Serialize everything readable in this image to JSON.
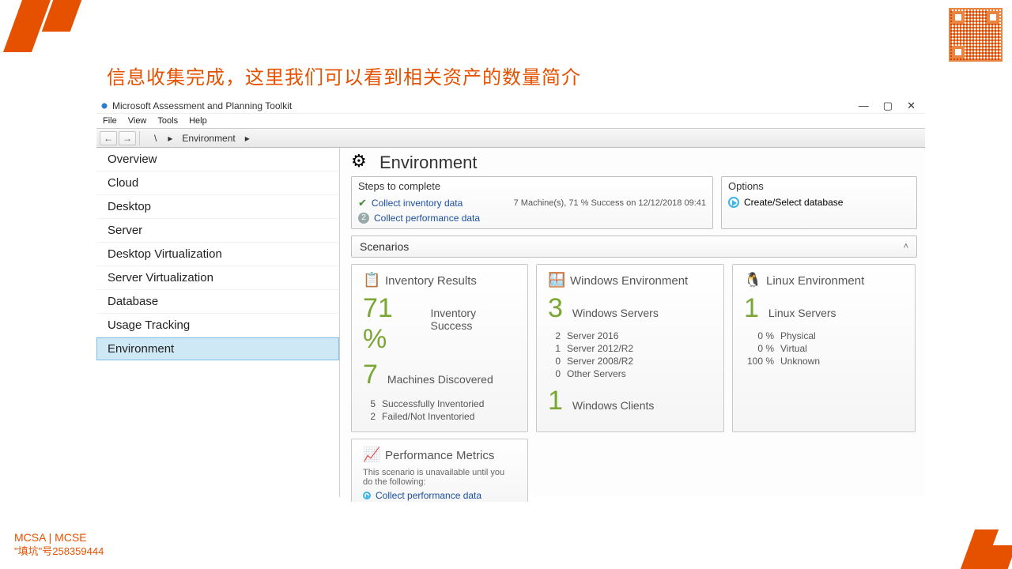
{
  "slide": {
    "title": "信息收集完成，这里我们可以看到相关资产的数量简介",
    "footer1": "MCSA | MCSE",
    "footer2": "\"填坑\"号258359444"
  },
  "window": {
    "title": "Microsoft Assessment and Planning Toolkit",
    "controls": {
      "min": "—",
      "max": "▢",
      "close": "✕"
    },
    "menu": [
      "File",
      "View",
      "Tools",
      "Help"
    ],
    "breadcrumb": {
      "back": "←",
      "fwd": "→",
      "root": "\\",
      "sep": "▸",
      "current": "Environment",
      "sep2": "▸"
    }
  },
  "sidebar": {
    "items": [
      "Overview",
      "Cloud",
      "Desktop",
      "Server",
      "Desktop Virtualization",
      "Server Virtualization",
      "Database",
      "Usage Tracking",
      "Environment"
    ]
  },
  "page": {
    "title": "Environment"
  },
  "steps": {
    "heading": "Steps to complete",
    "s1": "Collect inventory data",
    "s1status": "7 Machine(s), 71 % Success on 12/12/2018 09:41",
    "s2": "Collect performance data"
  },
  "options": {
    "heading": "Options",
    "link": "Create/Select database"
  },
  "scenarios": {
    "heading": "Scenarios",
    "chev": "˄"
  },
  "inv": {
    "title": "Inventory Results",
    "pct": "71 %",
    "pct_label": "Inventory Success",
    "machines": "7",
    "machines_label": "Machines Discovered",
    "succ_n": "5",
    "succ": "Successfully Inventoried",
    "fail_n": "2",
    "fail": "Failed/Not Inventoried"
  },
  "win": {
    "title": "Windows Environment",
    "servers_n": "3",
    "servers": "Windows Servers",
    "r1n": "2",
    "r1": "Server 2016",
    "r2n": "1",
    "r2": "Server 2012/R2",
    "r3n": "0",
    "r3": "Server 2008/R2",
    "r4n": "0",
    "r4": "Other Servers",
    "clients_n": "1",
    "clients": "Windows Clients"
  },
  "lin": {
    "title": "Linux Environment",
    "servers_n": "1",
    "servers": "Linux Servers",
    "p1n": "0 %",
    "p1": "Physical",
    "p2n": "0 %",
    "p2": "Virtual",
    "p3n": "100 %",
    "p3": "Unknown"
  },
  "perf": {
    "title": "Performance Metrics",
    "desc": "This scenario is unavailable until you do the following:",
    "link": "Collect performance data"
  }
}
